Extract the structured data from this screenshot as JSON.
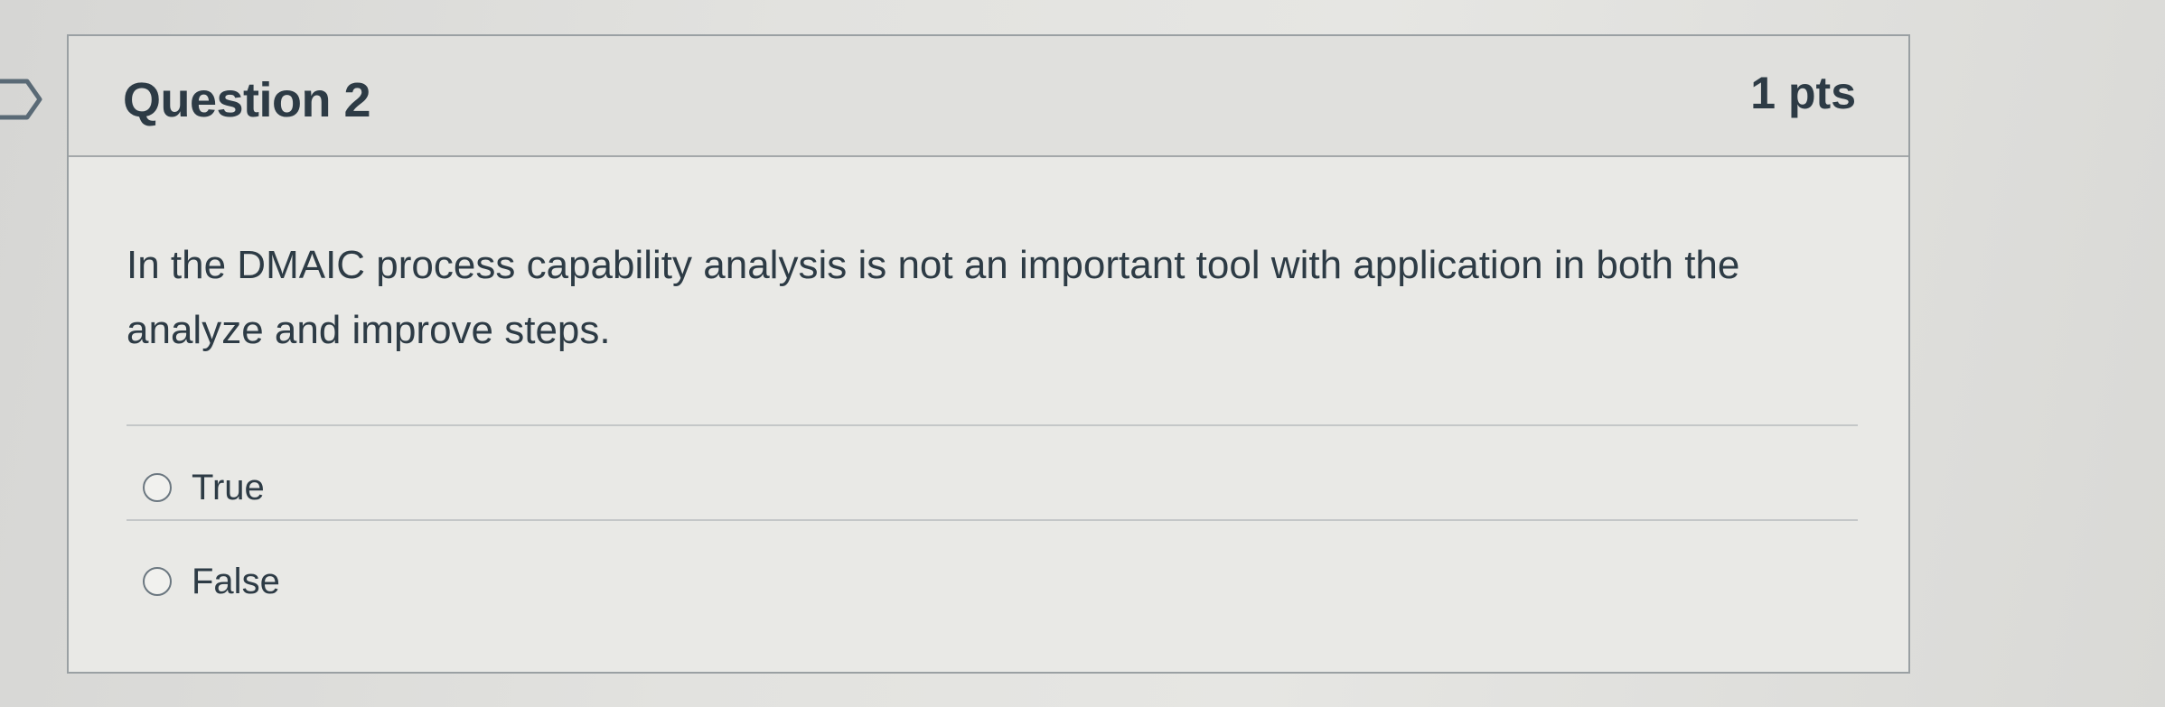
{
  "question": {
    "title": "Question 2",
    "points": "1 pts",
    "text": "In the DMAIC process capability analysis is not an important tool with application in both the analyze and improve steps.",
    "answers": [
      {
        "label": "True",
        "selected": false
      },
      {
        "label": "False",
        "selected": false
      }
    ]
  },
  "icons": {
    "flag": "flag-marker-icon",
    "radio": "radio-unchecked-icon"
  },
  "colors": {
    "text": "#2d3b45",
    "border": "#9aa0a3",
    "header_bg": "#e0e0dd"
  }
}
